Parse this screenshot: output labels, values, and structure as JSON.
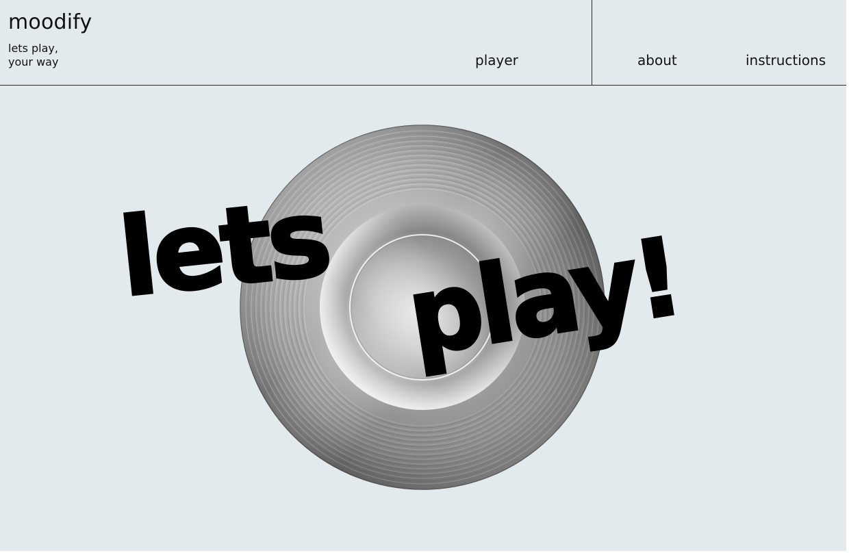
{
  "header": {
    "brand": "moodify",
    "tagline_line1": "lets play,",
    "tagline_line2": "your way"
  },
  "nav": {
    "player": "player",
    "about": "about",
    "instructions": "instructions"
  },
  "hero": {
    "word_one": "lets",
    "word_two": "play!",
    "disc_icon": "vinyl-record-icon"
  },
  "colors": {
    "background": "#e3eaee",
    "text": "#111111",
    "rule": "#2a2a2a"
  }
}
